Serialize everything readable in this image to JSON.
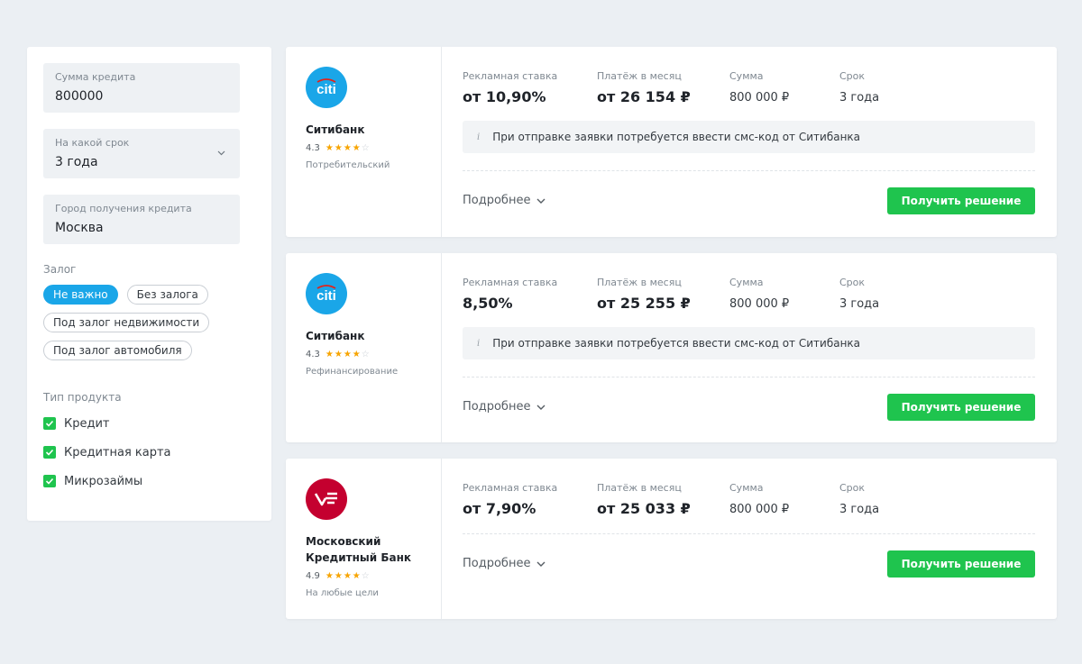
{
  "filters": {
    "amount": {
      "label": "Сумма кредита",
      "value": "800000"
    },
    "term": {
      "label": "На какой срок",
      "value": "3 года"
    },
    "city": {
      "label": "Город получения кредита",
      "value": "Москва"
    },
    "collateral": {
      "label": "Залог",
      "options": [
        "Не важно",
        "Без залога",
        "Под залог недвижимости",
        "Под залог автомобиля"
      ],
      "selected": "Не важно"
    },
    "product_type": {
      "label": "Тип продукта",
      "items": [
        {
          "label": "Кредит",
          "checked": true
        },
        {
          "label": "Кредитная карта",
          "checked": true
        },
        {
          "label": "Микрозаймы",
          "checked": true
        }
      ]
    }
  },
  "columns": {
    "rate": "Рекламная ставка",
    "payment": "Платёж в месяц",
    "sum": "Сумма",
    "term": "Срок"
  },
  "offers": [
    {
      "bank": "Ситибанк",
      "logo_text": "citi",
      "rating": "4.3",
      "stars": 4,
      "product": "Потребительский",
      "rate": "от 10,90%",
      "payment": "от 26 154 ₽",
      "sum": "800 000 ₽",
      "term": "3 года",
      "note": "При отправке заявки потребуется ввести смс-код от Ситибанка",
      "more": "Подробнее",
      "button": "Получить решение"
    },
    {
      "bank": "Ситибанк",
      "logo_text": "citi",
      "rating": "4.3",
      "stars": 4,
      "product": "Рефинансирование",
      "rate": "8,50%",
      "payment": "от 25 255 ₽",
      "sum": "800 000 ₽",
      "term": "3 года",
      "note": "При отправке заявки потребуется ввести смс-код от Ситибанка",
      "more": "Подробнее",
      "button": "Получить решение"
    },
    {
      "bank": "Московский Кредитный Банк",
      "rating": "4.9",
      "stars": 4,
      "product": "На любые цели",
      "rate": "от 7,90%",
      "payment": "от 25 033 ₽",
      "sum": "800 000 ₽",
      "term": "3 года",
      "more": "Подробнее",
      "button": "Получить решение"
    }
  ],
  "colors": {
    "accent_blue": "#1aa6e8",
    "accent_green": "#1fc44e",
    "mkb_red": "#c4002f",
    "star": "#f7a400"
  }
}
